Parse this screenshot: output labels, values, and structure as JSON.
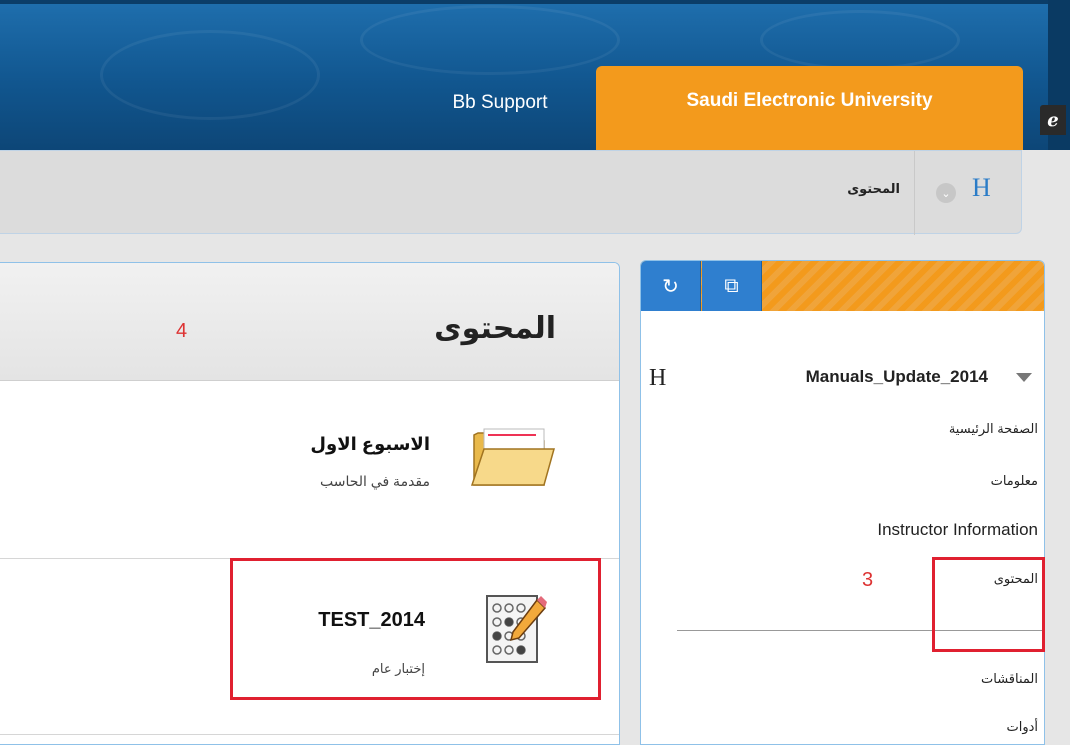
{
  "header": {
    "tabs": [
      {
        "label": "Bb Support"
      },
      {
        "label": "Saudi Electronic University"
      }
    ],
    "link_icon": "ɑ"
  },
  "breadcrumb": {
    "current": "المحتوى",
    "home_glyph": "H"
  },
  "content": {
    "title": "المحتوى",
    "items": [
      {
        "title": "الاسبوع الاول",
        "description": "مقدمة في الحاسب",
        "icon": "folder-icon"
      },
      {
        "title": "TEST_2014",
        "description": "إختبار عام",
        "icon": "test-icon"
      }
    ],
    "annotation": "4"
  },
  "course_menu": {
    "toolbar": {
      "refresh_icon": "refresh-icon",
      "window_icon": "window-icon"
    },
    "h_glyph": "H",
    "course_name": "Manuals_Update_2014",
    "items": [
      {
        "label": "الصفحة الرئيسية"
      },
      {
        "label": "معلومات"
      },
      {
        "label": "Instructor Information"
      },
      {
        "label": "المحتوى"
      },
      {
        "label": "المناقشات"
      },
      {
        "label": "أدوات"
      }
    ],
    "annotation": "3"
  },
  "colors": {
    "header_blue": "#11568f",
    "accent_orange": "#f39a1c",
    "link_blue": "#2b7cc7",
    "annotation_red": "#e02030"
  }
}
